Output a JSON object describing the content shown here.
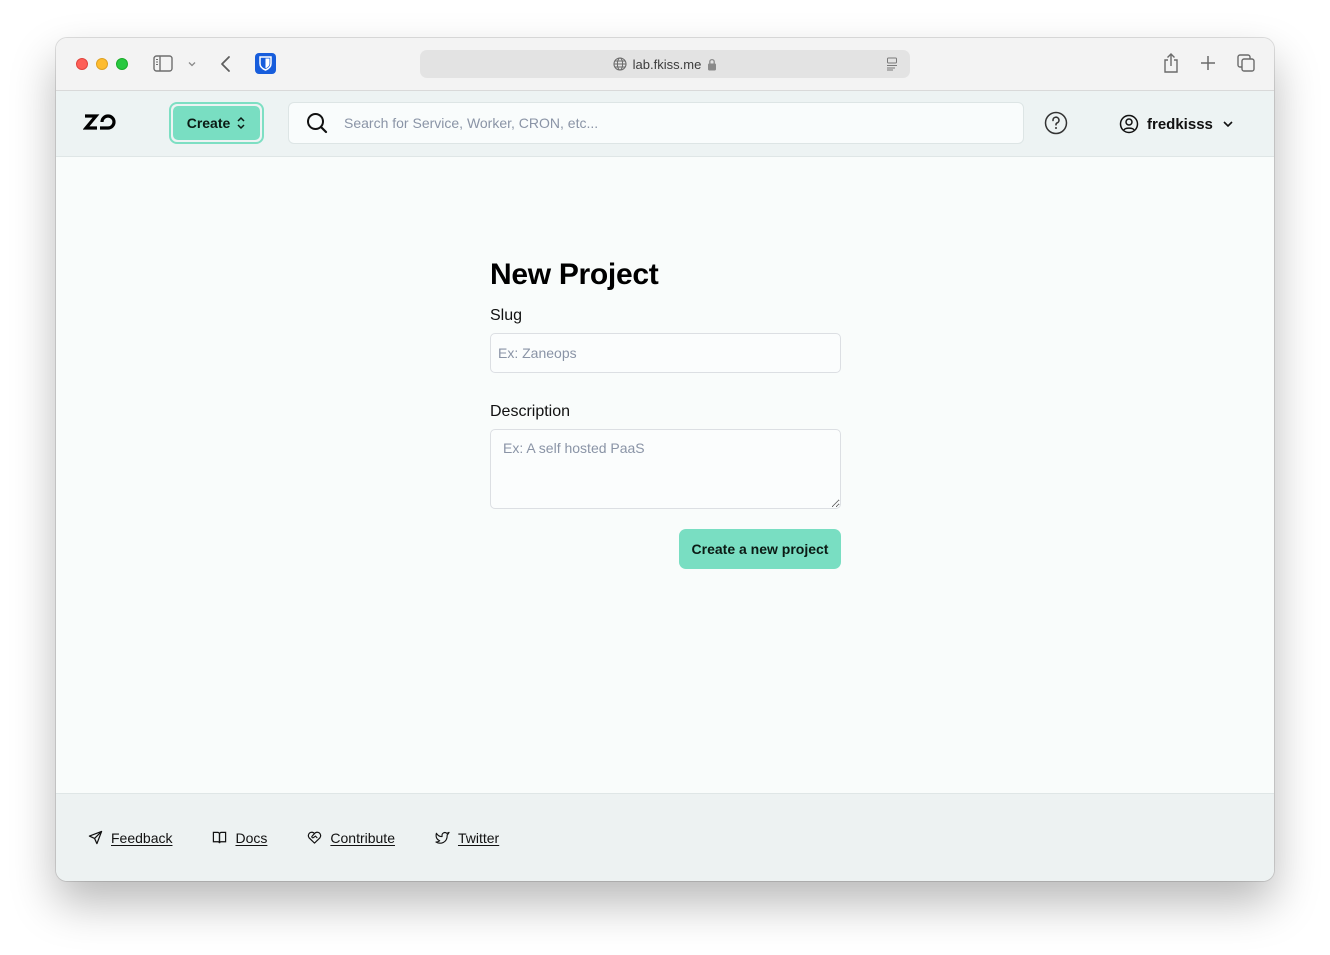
{
  "browser": {
    "url": "lab.fkiss.me",
    "secure": true,
    "icons": {
      "sidebar": "sidebar-icon",
      "back": "chevron-left-icon",
      "extension": "bitwarden-shield-icon",
      "share": "share-icon",
      "new_tab": "plus-icon",
      "tabs": "tab-overview-icon"
    }
  },
  "header": {
    "logo_text": "ZO",
    "create_label": "Create",
    "search_placeholder": "Search for Service, Worker, CRON, etc...",
    "username": "fredkisss"
  },
  "form": {
    "title": "New Project",
    "slug_label": "Slug",
    "slug_value": "",
    "slug_placeholder": "Ex: Zaneops",
    "description_label": "Description",
    "description_value": "",
    "description_placeholder": "Ex: A self hosted PaaS",
    "submit_label": "Create a new project"
  },
  "footer": {
    "links": [
      {
        "label": "Feedback",
        "icon": "send-icon"
      },
      {
        "label": "Docs",
        "icon": "book-open-icon"
      },
      {
        "label": "Contribute",
        "icon": "heart-handshake-icon"
      },
      {
        "label": "Twitter",
        "icon": "twitter-icon"
      }
    ]
  },
  "colors": {
    "accent": "#79dec2",
    "header_bg": "#edf3f3",
    "page_bg": "#f9fcfb"
  }
}
